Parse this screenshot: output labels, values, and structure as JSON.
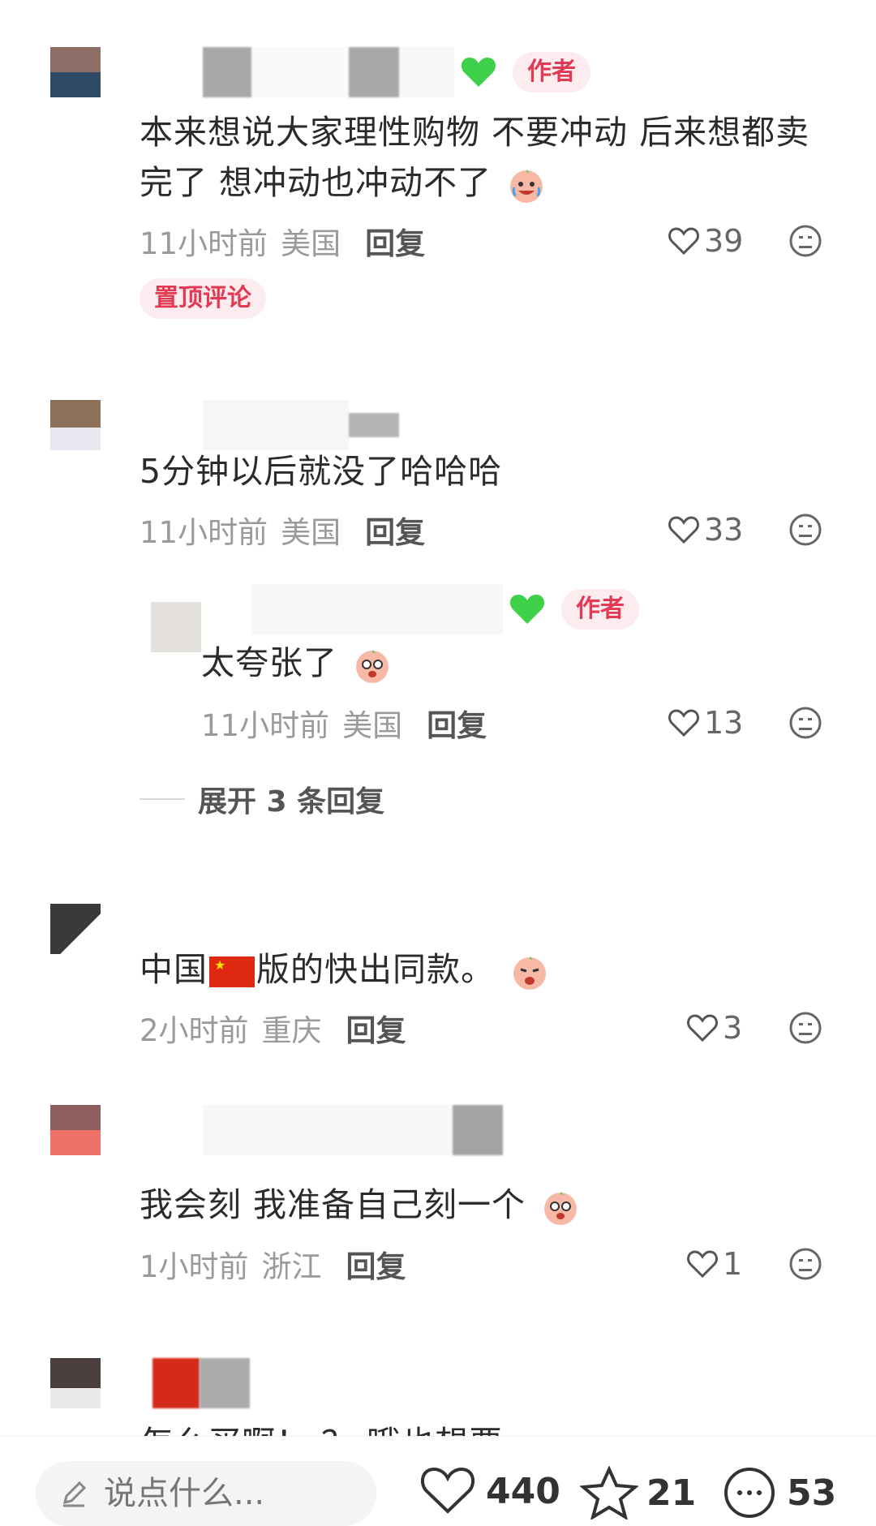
{
  "comments": [
    {
      "author_tag": "作者",
      "text": "本来想说大家理性购物 不要冲动 后来想都卖完了 想冲动也冲动不了",
      "time": "11小时前",
      "location": "美国",
      "reply_label": "回复",
      "likes": "39",
      "pinned_label": "置顶评论"
    },
    {
      "text": "5分钟以后就没了哈哈哈",
      "time": "11小时前",
      "location": "美国",
      "reply_label": "回复",
      "likes": "33",
      "sub_reply": {
        "author_tag": "作者",
        "text": "太夸张了",
        "time": "11小时前",
        "location": "美国",
        "reply_label": "回复",
        "likes": "13"
      },
      "expand_label": "展开 3 条回复"
    },
    {
      "text_before_flag": "中国",
      "text_after_flag": "版的快出同款。",
      "time": "2小时前",
      "location": "重庆",
      "reply_label": "回复",
      "likes": "3"
    },
    {
      "text": "我会刻 我准备自己刻一个",
      "time": "1小时前",
      "location": "浙江",
      "reply_label": "回复",
      "likes": "1"
    },
    {
      "text_partial": "怎么买啊！  ？ 哦也想要"
    }
  ],
  "bottom_bar": {
    "input_placeholder": "说点什么...",
    "like_count": "440",
    "collect_count": "21",
    "comment_count": "53"
  },
  "colors": {
    "accent_red": "#e33a54",
    "tag_bg": "#fdecef",
    "meta_gray": "#9a9a9a",
    "badge_green": "#3fd14a"
  },
  "icons": [
    "heart-outline-icon",
    "dislike-face-icon",
    "green-heart-icon",
    "pencil-icon",
    "star-outline-icon",
    "comment-bubble-icon"
  ]
}
